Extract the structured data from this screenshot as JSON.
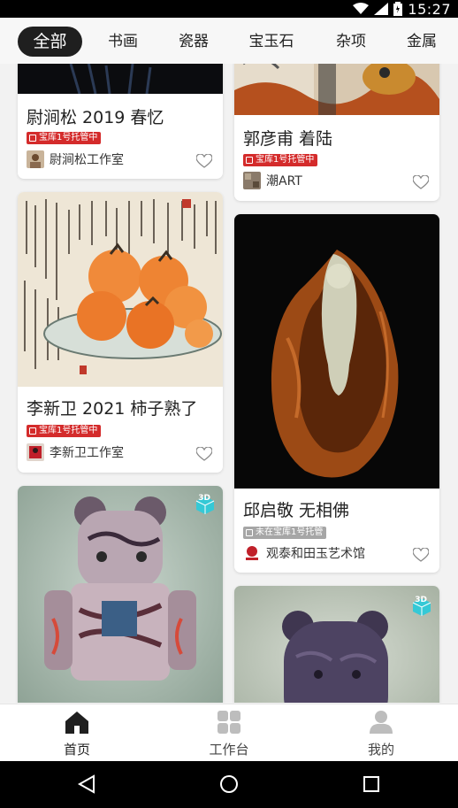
{
  "status_bar": {
    "time": "15:27"
  },
  "tabs": [
    "全部",
    "书画",
    "瓷器",
    "宝玉石",
    "杂项",
    "金属"
  ],
  "cards": {
    "c1": {
      "title": "尉涧松 2019 春忆",
      "badge": "宝库1号托管中",
      "owner": "尉涧松工作室"
    },
    "c2": {
      "title": "郭彦甫 着陆",
      "badge": "宝库1号托管中",
      "owner": "潮ART"
    },
    "c3": {
      "title": "李新卫 2021 柿子熟了",
      "badge": "宝库1号托管中",
      "owner": "李新卫工作室"
    },
    "c4": {
      "title": "邱启敬 无相佛",
      "badge": "未在宝库1号托管",
      "owner": "观泰和田玉艺术馆"
    },
    "c5": {
      "badge3d": "3D"
    },
    "c6": {
      "badge3d": "3D"
    }
  },
  "bottom_nav": {
    "home": "首页",
    "workbench": "工作台",
    "mine": "我的"
  },
  "colors": {
    "badge_red": "#d42b2b",
    "badge_gray": "#a6a6a6",
    "active_tab": "#1f1f1f",
    "accent_3d": "#35c9d6"
  },
  "icons": [
    "wifi-icon",
    "signal-icon",
    "battery-icon",
    "heart-icon",
    "home-icon",
    "grid-icon",
    "person-icon",
    "back-icon",
    "circle-home-icon",
    "recents-icon"
  ]
}
